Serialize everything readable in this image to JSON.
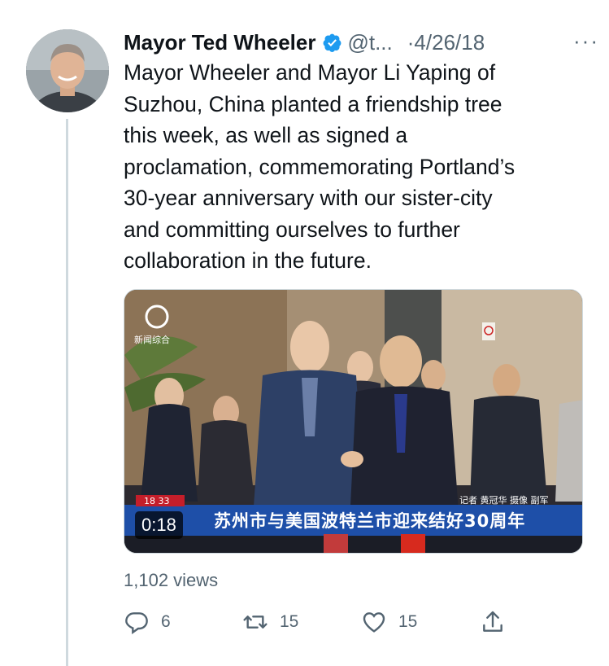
{
  "tweet": {
    "author_name": "Mayor Ted Wheeler",
    "handle": "@t...",
    "date": "·4/26/18",
    "more": "···",
    "text": "Mayor Wheeler and Mayor Li Yaping of\nSuzhou, China planted a friendship tree\nthis week, as well as signed a\nproclamation, commemorating Portland’s\n30-year anniversary with our sister-city\nand committing ourselves to further\ncollaboration in the future.",
    "views": "1,102 views"
  },
  "video": {
    "duration": "0:18",
    "caption": "苏州市与美国波特兰市迎来结好30周年",
    "time_stamp": "18 33",
    "credits": "记者 黄冠华 摄像 副军",
    "channel_label": "新闻综合"
  },
  "actions": {
    "reply_count": "6",
    "retweet_count": "15",
    "like_count": "15"
  },
  "colors": {
    "verified": "#1d9bf0",
    "secondary_text": "#536471",
    "thread_line": "#cfd9de",
    "caption_bar": "#1e4fa8"
  },
  "icons": {
    "verified": "verified-badge-icon",
    "reply": "reply-icon",
    "retweet": "retweet-icon",
    "like": "heart-icon",
    "share": "share-icon"
  }
}
